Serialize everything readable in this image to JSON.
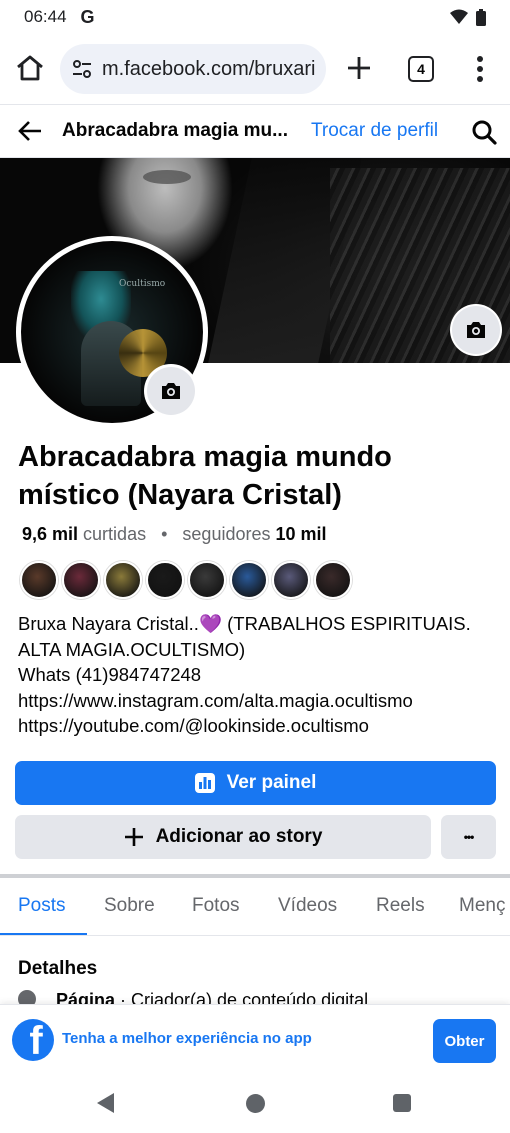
{
  "status_bar": {
    "time": "06:44",
    "google_icon": "G"
  },
  "browser": {
    "url": "m.facebook.com/bruxari",
    "tab_count": "4"
  },
  "header": {
    "title": "Abracadabra magia mu...",
    "switch_profile": "Trocar de perfil"
  },
  "profile": {
    "name": "Abracadabra magia mundo místico (Nayara Cristal)",
    "likes_count": "9,6 mil",
    "likes_label": "curtidas",
    "dot": "•",
    "followers_label": "seguidores",
    "followers_count": "10 mil",
    "avatar_text": "Ocultismo"
  },
  "follower_avatar_colors": [
    "#5a3a2a",
    "#6b2a3a",
    "#8a7a3a",
    "#1a1a1a",
    "#3a3a3a",
    "#2a5a9a",
    "#5a5a7a",
    "#3a2a2a"
  ],
  "bio": {
    "line1_name": "Bruxa Nayara Cristal..",
    "line1_heart": "💜",
    "line1_rest": " (TRABALHOS ESPIRITUAIS.",
    "line2": "ALTA MAGIA.OCULTISMO)",
    "line3": "Whats (41)984747248",
    "line4": "https://www.instagram.com/alta.magia.ocultismo",
    "line5": "https://youtube.com/@lookinside.ocultismo"
  },
  "actions": {
    "dashboard": "Ver painel",
    "add_story": "Adicionar ao story",
    "more": "•••"
  },
  "tabs": [
    "Posts",
    "Sobre",
    "Fotos",
    "Vídeos",
    "Reels",
    "Menç"
  ],
  "details": {
    "title": "Detalhes",
    "row_bold": "Página",
    "row_rest": " · Criador(a) de conteúdo digital"
  },
  "app_banner": {
    "text": "Tenha a melhor experiência no app",
    "button": "Obter",
    "logo": "f"
  },
  "colors": {
    "accent": "#1877f2",
    "secondary_bg": "#e4e6eb",
    "muted_text": "#65676b"
  }
}
